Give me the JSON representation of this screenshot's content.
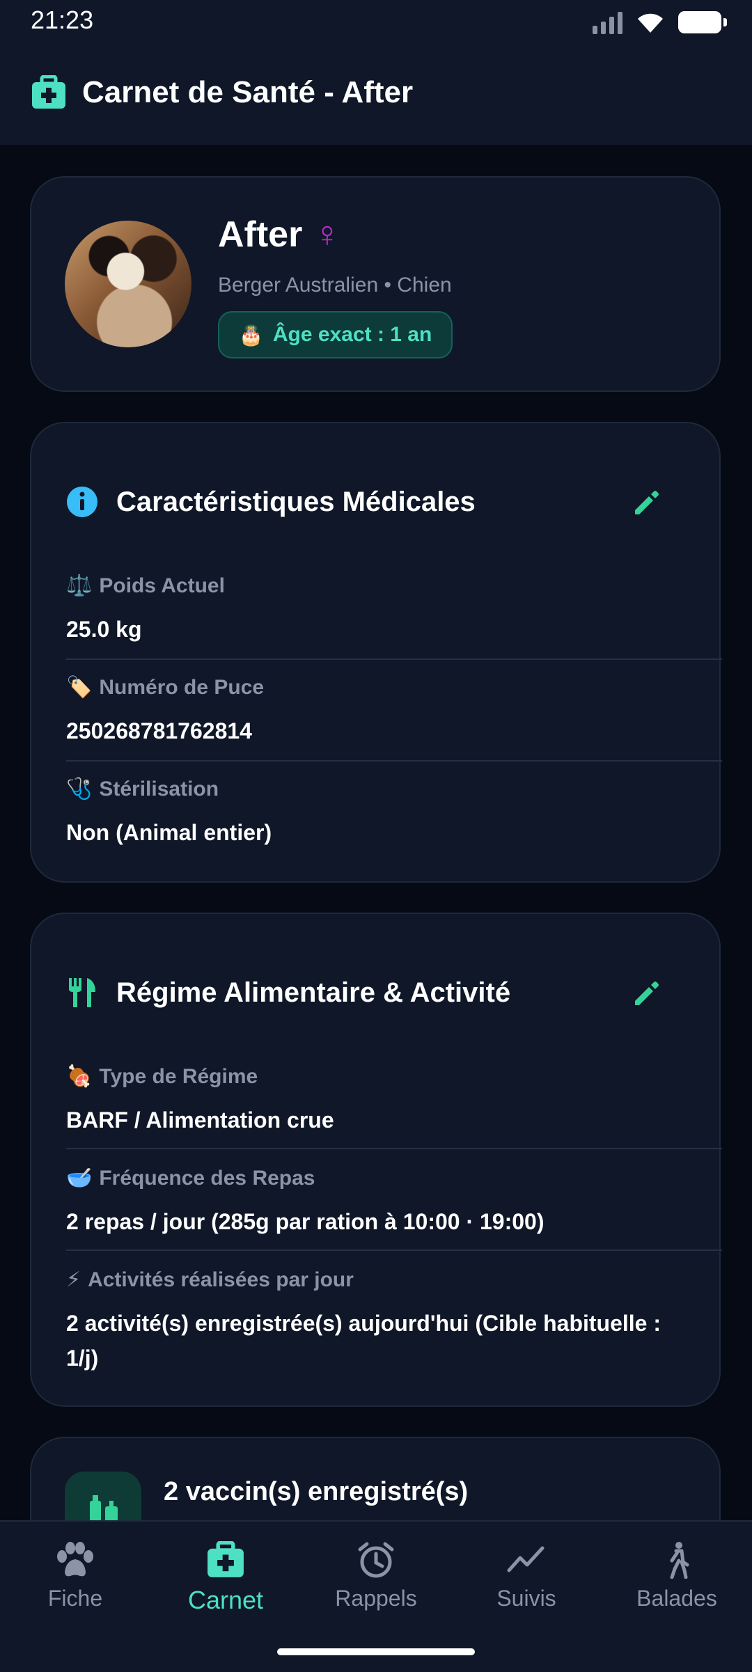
{
  "status": {
    "time": "21:23"
  },
  "header": {
    "title": "Carnet de Santé - After",
    "icon": "medical-kit-icon"
  },
  "profile": {
    "name": "After",
    "sex_symbol": "♀",
    "breed": "Berger Australien • Chien",
    "age_badge": "Âge exact : 1 an",
    "age_icon": "🎂"
  },
  "medical": {
    "title": "Caractéristiques Médicales",
    "fields": [
      {
        "emoji": "⚖️",
        "label": "Poids Actuel",
        "value": "25.0 kg"
      },
      {
        "emoji": "🏷️",
        "label": "Numéro de Puce",
        "value": "250268781762814"
      },
      {
        "emoji": "🩺",
        "label": "Stérilisation",
        "value": "Non (Animal entier)"
      }
    ]
  },
  "diet": {
    "title": "Régime Alimentaire & Activité",
    "fields": [
      {
        "emoji": "🍖",
        "label": "Type de Régime",
        "value": "BARF / Alimentation crue"
      },
      {
        "emoji": "🥣",
        "label": "Fréquence des Repas",
        "value": "2 repas / jour (285g par ration à 10:00 · 19:00)"
      },
      {
        "emoji": "⚡",
        "label": "Activités réalisées par jour",
        "value": "2 activité(s) enregistrée(s) aujourd'hui (Cible habituelle : 1/j)"
      }
    ]
  },
  "vaccines": {
    "title": "2 vaccin(s) enregistré(s)"
  },
  "nav": [
    {
      "label": "Fiche",
      "icon": "paw-icon"
    },
    {
      "label": "Carnet",
      "icon": "medical-kit-icon",
      "active": true
    },
    {
      "label": "Rappels",
      "icon": "alarm-clock-icon"
    },
    {
      "label": "Suivis",
      "icon": "trend-line-icon"
    },
    {
      "label": "Balades",
      "icon": "walking-person-icon"
    }
  ],
  "colors": {
    "accent": "#4ee0c2",
    "background": "#050a14",
    "card": "#0f1728",
    "muted": "#8a94a6",
    "info": "#38bdf8",
    "female": "#c026d3"
  }
}
